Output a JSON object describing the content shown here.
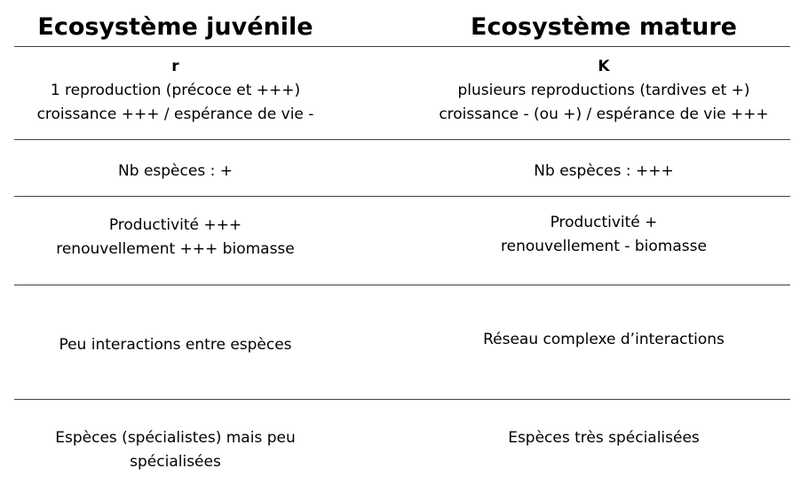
{
  "headers": {
    "left": "Ecosystème juvénile",
    "right": "Ecosystème mature"
  },
  "rows": [
    {
      "left": {
        "letter": "r",
        "lines": [
          "1 reproduction (précoce et +++)",
          "croissance +++ / espérance de vie -"
        ]
      },
      "right": {
        "letter": "K",
        "lines": [
          "plusieurs reproductions (tardives et +)",
          "croissance - (ou +) / espérance de vie +++"
        ]
      }
    },
    {
      "left": {
        "lines": [
          "Nb espèces : +"
        ]
      },
      "right": {
        "lines": [
          "Nb espèces : +++"
        ]
      }
    },
    {
      "left": {
        "lines": [
          "Productivité +++",
          "renouvellement +++ biomasse"
        ]
      },
      "right": {
        "lines": [
          "Productivité +",
          "renouvellement - biomasse"
        ]
      }
    },
    {
      "left": {
        "lines": [
          "Peu interactions entre espèces"
        ]
      },
      "right": {
        "lines": [
          "Réseau complexe d’interactions"
        ]
      }
    },
    {
      "left": {
        "lines": [
          "Espèces (spécialistes) mais peu",
          "spécialisées"
        ]
      },
      "right": {
        "lines": [
          "Espèces très spécialisées"
        ]
      }
    }
  ]
}
